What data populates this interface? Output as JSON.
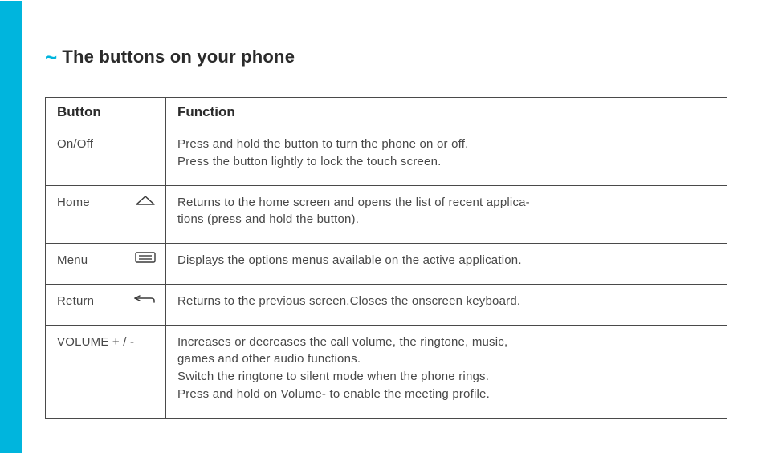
{
  "title": {
    "tilde": "~",
    "text": "The buttons on your phone"
  },
  "table": {
    "headers": {
      "button": "Button",
      "function": "Function"
    },
    "rows": [
      {
        "button": "On/Off",
        "icon": "",
        "lines": [
          "Press and hold the button to turn the phone on or off.",
          "Press the button lightly to lock the touch screen."
        ]
      },
      {
        "button": "Home",
        "icon": "home-icon",
        "lines": [
          "Returns to the home screen and opens the list of recent applica-",
          "tions (press and hold the button)."
        ]
      },
      {
        "button": "Menu",
        "icon": "menu-icon",
        "lines": [
          "Displays the options menus available on the active application."
        ]
      },
      {
        "button": "Return",
        "icon": "return-icon",
        "lines": [
          "Returns to the previous screen.Closes the onscreen keyboard."
        ]
      },
      {
        "button": "VOLUME + / -",
        "icon": "",
        "justify": true,
        "lines": [
          "Increases or decreases the call volume, the ringtone, music,",
          "games and other audio functions.",
          "Switch the ringtone to silent mode when the phone rings.",
          "Press and hold on Volume- to enable the meeting profile."
        ]
      }
    ]
  }
}
